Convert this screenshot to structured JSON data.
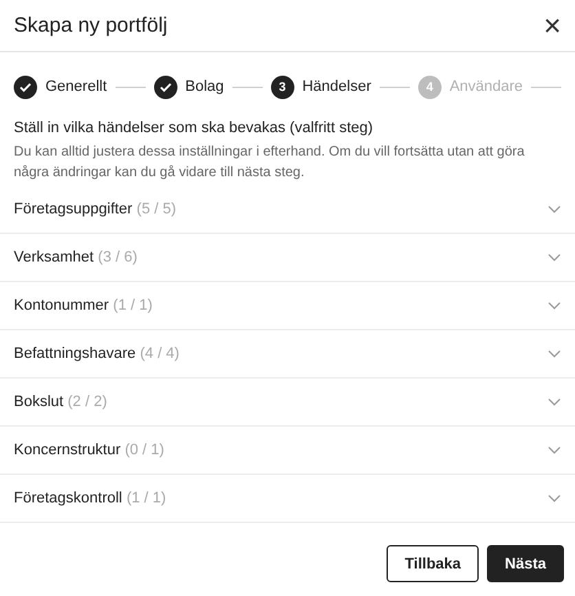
{
  "dialog": {
    "title": "Skapa ny portfölj",
    "close": "×"
  },
  "steps": [
    {
      "label": "Generellt",
      "kind": "done"
    },
    {
      "label": "Bolag",
      "kind": "done"
    },
    {
      "label": "Händelser",
      "kind": "current",
      "number": "3"
    },
    {
      "label": "Användare",
      "kind": "upcoming",
      "number": "4"
    }
  ],
  "heading": "Ställ in vilka händelser som ska bevakas (valfritt steg)",
  "description": "Du kan alltid justera dessa inställningar i efterhand. Om du vill fortsätta utan att göra några ändringar kan du gå vidare till nästa steg.",
  "sections": [
    {
      "name": "Företagsuppgifter",
      "count": "(5 / 5)",
      "expanded": false
    },
    {
      "name": "Verksamhet",
      "count": "(3 / 6)",
      "expanded": false
    },
    {
      "name": "Kontonummer",
      "count": "(1 / 1)",
      "expanded": false
    },
    {
      "name": "Befattningshavare",
      "count": "(4 / 4)",
      "expanded": false
    },
    {
      "name": "Bokslut",
      "count": "(2 / 2)",
      "expanded": false
    },
    {
      "name": "Koncernstruktur",
      "count": "(0 / 1)",
      "expanded": false
    },
    {
      "name": "Företagskontroll",
      "count": "(1 / 1)",
      "expanded": false
    }
  ],
  "buttons": [
    {
      "label": "Tillbaka",
      "kind": "secondary"
    },
    {
      "label": "Nästa",
      "kind": "primary"
    }
  ]
}
